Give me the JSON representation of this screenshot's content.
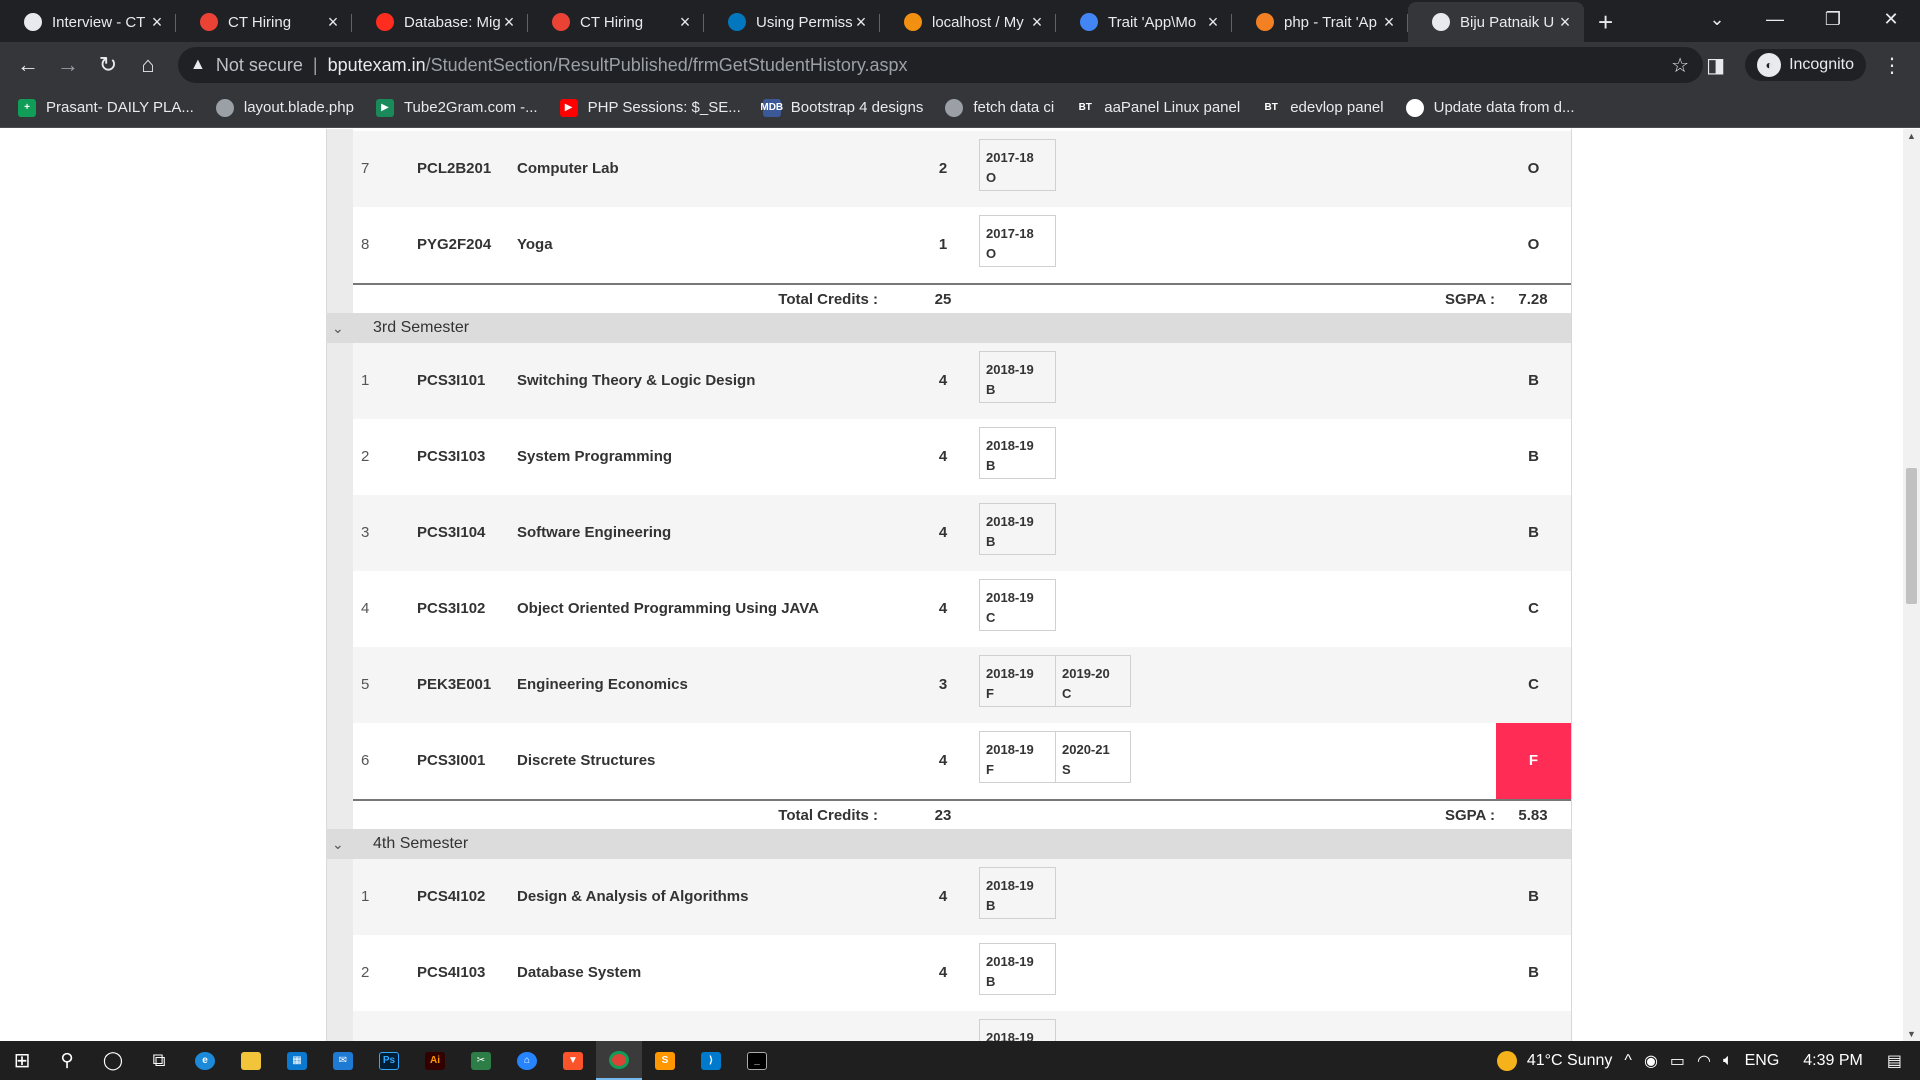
{
  "browser": {
    "tabs": [
      {
        "title": "Interview - CT",
        "icon": "globe-icon",
        "color": "#e8eaed"
      },
      {
        "title": "CT Hiring",
        "icon": "gmail-icon",
        "color": "#ea4335"
      },
      {
        "title": "Database: Mig",
        "icon": "laravel-icon",
        "color": "#ff2d20"
      },
      {
        "title": "CT Hiring",
        "icon": "gmail-icon",
        "color": "#ea4335"
      },
      {
        "title": "Using Permiss",
        "icon": "s-icon",
        "color": "#0277bd"
      },
      {
        "title": "localhost / My",
        "icon": "phpmyadmin-icon",
        "color": "#f29111"
      },
      {
        "title": "Trait 'App\\Mo",
        "icon": "google-icon",
        "color": "#4285f4"
      },
      {
        "title": "php - Trait 'Ap",
        "icon": "stackoverflow-icon",
        "color": "#f48024"
      },
      {
        "title": "Biju Patnaik U",
        "icon": "globe-icon",
        "color": "#e8eaed",
        "active": true
      }
    ],
    "address": {
      "security": "Not secure",
      "host": "bputexam.in",
      "path": "/StudentSection/ResultPublished/frmGetStudentHistory.aspx"
    },
    "profile_label": "Incognito",
    "bookmarks": [
      {
        "label": "Prasant- DAILY PLA...",
        "color": "#0f9d58",
        "glyph": "+"
      },
      {
        "label": "layout.blade.php",
        "color": "#9aa0a6",
        "glyph": ""
      },
      {
        "label": "Tube2Gram.com -...",
        "color": "#1a8a5a",
        "glyph": "▶"
      },
      {
        "label": "PHP Sessions: $_SE...",
        "color": "#ff0000",
        "glyph": "▶"
      },
      {
        "label": "Bootstrap 4 designs",
        "color": "#3b5998",
        "glyph": "MDB"
      },
      {
        "label": "fetch data ci",
        "color": "#9aa0a6",
        "glyph": ""
      },
      {
        "label": "aaPanel Linux panel",
        "color": "#35363a",
        "glyph": "BT"
      },
      {
        "label": "edevlop panel",
        "color": "#35363a",
        "glyph": "BT"
      },
      {
        "label": "Update data from d...",
        "color": "#ffffff",
        "glyph": ""
      }
    ]
  },
  "sections": [
    {
      "name": "",
      "rows": [
        {
          "sl": "7",
          "code": "PCL2B201",
          "name": "Computer Lab",
          "credit": "2",
          "sessions": [
            {
              "year": "2017-18",
              "grade": "O"
            }
          ],
          "grade": "O"
        },
        {
          "sl": "8",
          "code": "PYG2F204",
          "name": "Yoga",
          "credit": "1",
          "sessions": [
            {
              "year": "2017-18",
              "grade": "O"
            }
          ],
          "grade": "O"
        }
      ],
      "total_label": "Total Credits :",
      "total_credits": "25",
      "sgpa_label": "SGPA :",
      "sgpa": "7.28"
    },
    {
      "name": "3rd Semester",
      "rows": [
        {
          "sl": "1",
          "code": "PCS3I101",
          "name": "Switching Theory & Logic Design",
          "credit": "4",
          "sessions": [
            {
              "year": "2018-19",
              "grade": "B"
            }
          ],
          "grade": "B"
        },
        {
          "sl": "2",
          "code": "PCS3I103",
          "name": "System Programming",
          "credit": "4",
          "sessions": [
            {
              "year": "2018-19",
              "grade": "B"
            }
          ],
          "grade": "B"
        },
        {
          "sl": "3",
          "code": "PCS3I104",
          "name": "Software Engineering",
          "credit": "4",
          "sessions": [
            {
              "year": "2018-19",
              "grade": "B"
            }
          ],
          "grade": "B"
        },
        {
          "sl": "4",
          "code": "PCS3I102",
          "name": "Object Oriented Programming Using JAVA",
          "credit": "4",
          "sessions": [
            {
              "year": "2018-19",
              "grade": "C"
            }
          ],
          "grade": "C"
        },
        {
          "sl": "5",
          "code": "PEK3E001",
          "name": "Engineering Economics",
          "credit": "3",
          "sessions": [
            {
              "year": "2018-19",
              "grade": "F"
            },
            {
              "year": "2019-20",
              "grade": "C"
            }
          ],
          "grade": "C"
        },
        {
          "sl": "6",
          "code": "PCS3I001",
          "name": "Discrete Structures",
          "credit": "4",
          "sessions": [
            {
              "year": "2018-19",
              "grade": "F"
            },
            {
              "year": "2020-21",
              "grade": "S"
            }
          ],
          "grade": "F",
          "fail": true
        }
      ],
      "total_label": "Total Credits :",
      "total_credits": "23",
      "sgpa_label": "SGPA :",
      "sgpa": "5.83"
    },
    {
      "name": "4th Semester",
      "rows": [
        {
          "sl": "1",
          "code": "PCS4I102",
          "name": "Design & Analysis of Algorithms",
          "credit": "4",
          "sessions": [
            {
              "year": "2018-19",
              "grade": "B"
            }
          ],
          "grade": "B"
        },
        {
          "sl": "2",
          "code": "PCS4I103",
          "name": "Database System",
          "credit": "4",
          "sessions": [
            {
              "year": "2018-19",
              "grade": "B"
            }
          ],
          "grade": "B"
        },
        {
          "sl": "",
          "code": "",
          "name": "",
          "credit": "",
          "sessions": [
            {
              "year": "2018-19",
              "grade": ""
            }
          ],
          "grade": ""
        }
      ]
    }
  ],
  "taskbar": {
    "weather": "41°C  Sunny",
    "lang": "ENG",
    "time": "4:39 PM"
  },
  "colors": {
    "fail": "#ff2d55",
    "accent": "#76b9ed"
  }
}
